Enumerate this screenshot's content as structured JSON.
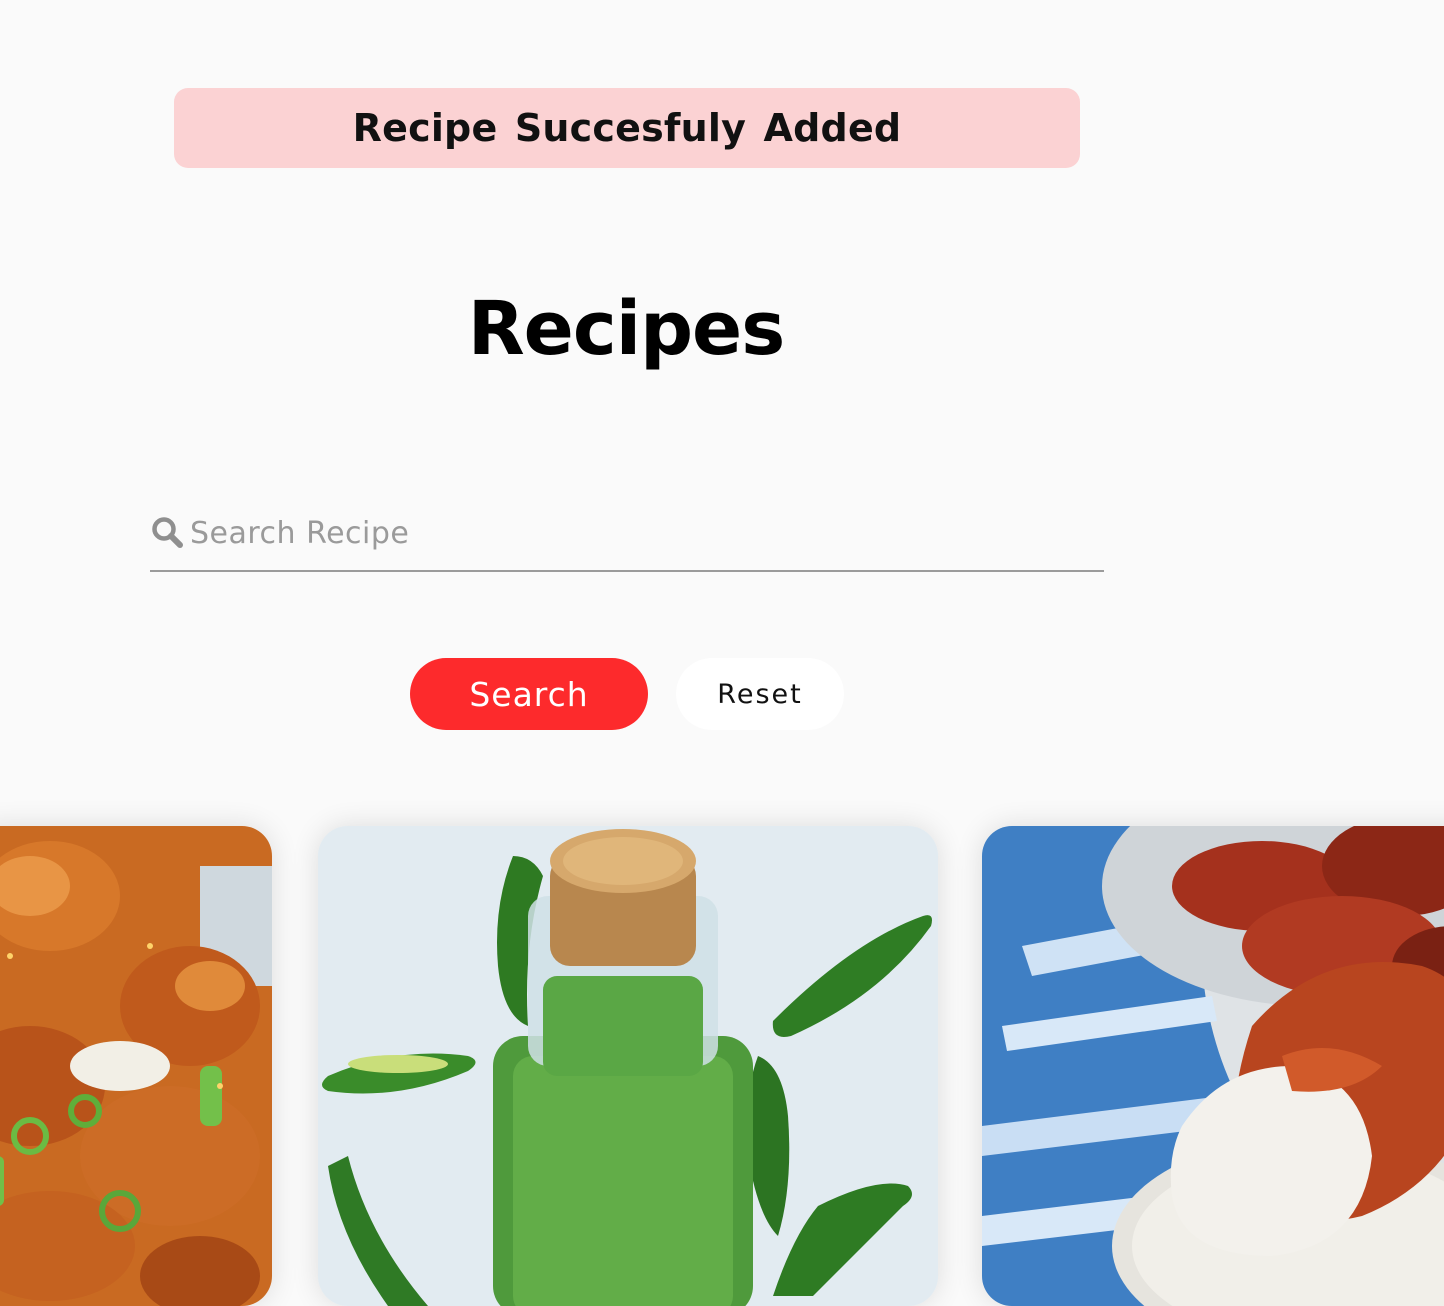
{
  "alert": {
    "message": "Recipe Succesfuly Added",
    "color": "#fbd2d3"
  },
  "page": {
    "title": "Recipes"
  },
  "search": {
    "icon": "search-icon",
    "placeholder": "Search Recipe",
    "value": ""
  },
  "buttons": {
    "search_label": "Search",
    "search_color": "#fd2a2c",
    "reset_label": "Reset"
  },
  "cards": [
    {
      "image": "orange-chicken-photo"
    },
    {
      "image": "green-jalapeno-sauce-bottle-photo"
    },
    {
      "image": "buffalo-wings-ranch-dip-photo"
    }
  ]
}
